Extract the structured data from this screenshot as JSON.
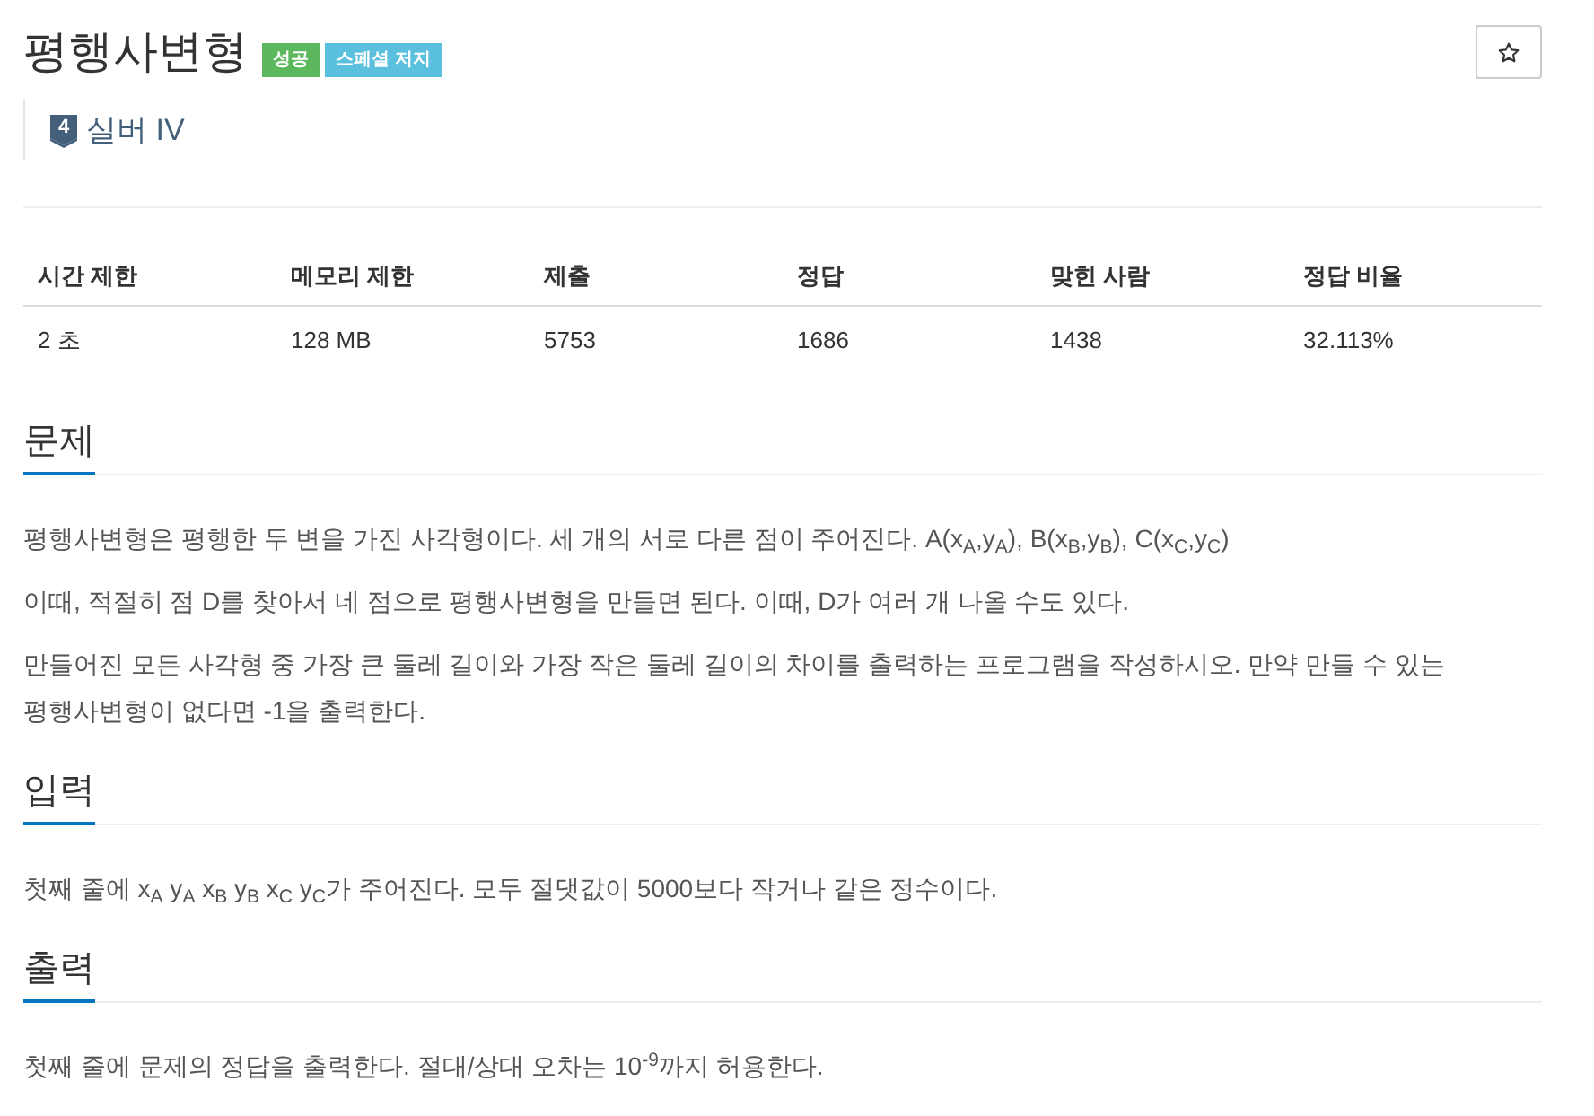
{
  "problem": {
    "title": "평행사변형",
    "badges": [
      {
        "label": "성공",
        "color": "#5cb85c"
      },
      {
        "label": "스페셜 저지",
        "color": "#5bc0de"
      }
    ],
    "starred": false,
    "tier": {
      "badge": "4",
      "label": "실버 IV"
    }
  },
  "stats_table": {
    "columns": [
      "시간 제한",
      "메모리 제한",
      "제출",
      "정답",
      "맞힌 사람",
      "정답 비율"
    ],
    "rows": [
      [
        "2 초",
        "128 MB",
        "5753",
        "1686",
        "1438",
        "32.113%"
      ]
    ]
  },
  "sections": [
    {
      "title": "문제",
      "paragraphs": [
        "평행사변형은 평행한 두 변을 가진 사각형이다. 세 개의 서로 다른 점이 주어진다. A(x$_{A}$,y$_{A}$), B(x$_{B}$,y$_{B}$), C(x$_{C}$,y$_{C}$)",
        "이때, 적절히 점 D를 찾아서 네 점으로 평행사변형을 만들면 된다. 이때, D가 여러 개 나올 수도 있다.",
        "만들어진 모든 사각형 중 가장 큰 둘레 길이와 가장 작은 둘레 길이의 차이를 출력하는 프로그램을 작성하시오. 만약 만들 수 있는 평행사변형이 없다면 -1을 출력한다."
      ]
    },
    {
      "title": "입력",
      "paragraphs": [
        "첫째 줄에 x$_{A}$ y$_{A}$ x$_{B}$ y$_{B}$ x$_{C}$ y$_{C}$가 주어진다. 모두 절댓값이 5000보다 작거나 같은 정수이다."
      ]
    },
    {
      "title": "출력",
      "paragraphs": [
        "첫째 줄에 문제의 정답을 출력한다. 절대/상대 오차는 10$^{-9}$까지 허용한다."
      ]
    }
  ]
}
